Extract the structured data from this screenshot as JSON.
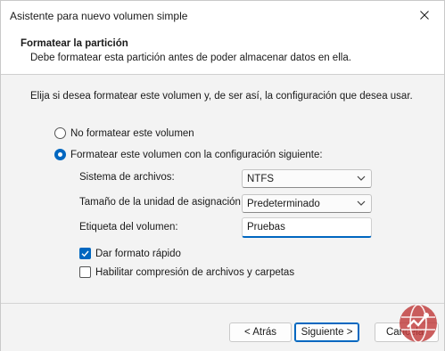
{
  "window": {
    "title": "Asistente para nuevo volumen simple"
  },
  "header": {
    "title": "Formatear la partición",
    "subtitle": "Debe formatear esta partición antes de poder almacenar datos en ella."
  },
  "content": {
    "intro": "Elija si desea formatear este volumen y, de ser así, la configuración que desea usar.",
    "radio_options": [
      {
        "label": "No formatear este volumen",
        "checked": false
      },
      {
        "label": "Formatear este volumen con la configuración siguiente:",
        "checked": true
      }
    ],
    "fields": {
      "filesystem": {
        "label": "Sistema de archivos:",
        "value": "NTFS"
      },
      "allocation": {
        "label": "Tamaño de la unidad de asignación:",
        "value": "Predeterminado"
      },
      "volume_label": {
        "label": "Etiqueta del volumen:",
        "value": "Pruebas"
      }
    },
    "checkboxes": [
      {
        "label": "Dar formato rápido",
        "checked": true
      },
      {
        "label": "Habilitar compresión de archivos y carpetas",
        "checked": false
      }
    ]
  },
  "buttons": {
    "back": "< Atrás",
    "next": "Siguiente >",
    "cancel": "Cancelar"
  },
  "colors": {
    "accent": "#0067c0",
    "body_bg": "#f3f3f3",
    "watermark": "#c03a3a"
  },
  "icons": {
    "close": "close-icon",
    "chevron": "chevron-down-icon",
    "check": "checkmark-icon",
    "watermark": "globe-logo"
  }
}
